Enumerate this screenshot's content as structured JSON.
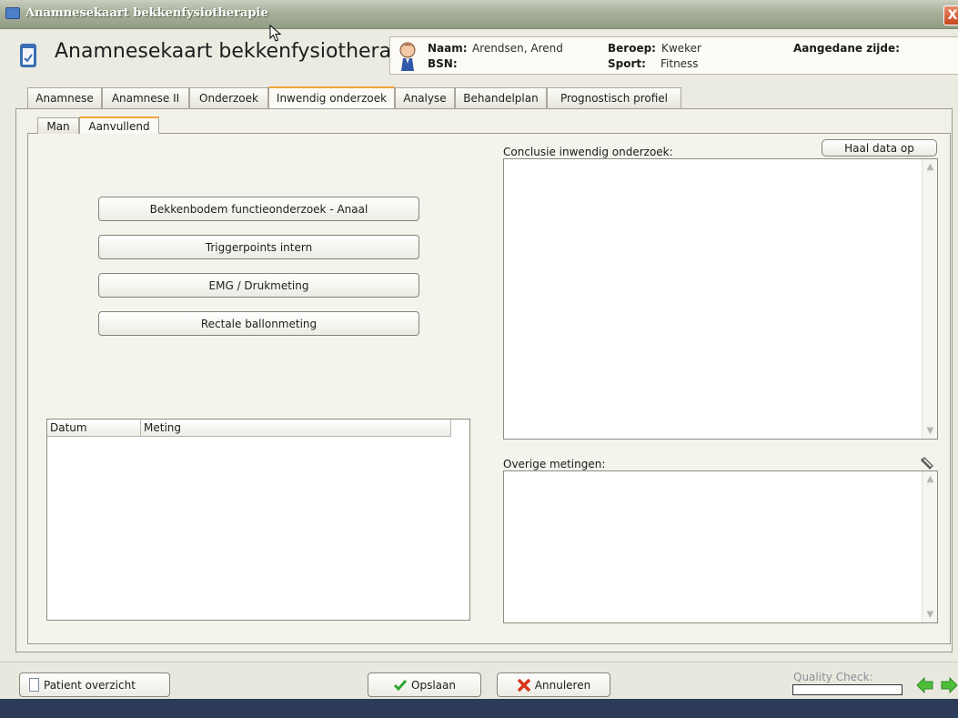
{
  "window": {
    "title": "Anamnesekaart bekkenfysiotherapie",
    "close_glyph": "X"
  },
  "header": {
    "app_title": "Anamnesekaart bekkenfysiotherapie",
    "patient": {
      "naam_label": "Naam:",
      "naam_value": "Arendsen, Arend",
      "bsn_label": "BSN:",
      "bsn_value": "",
      "beroep_label": "Beroep:",
      "beroep_value": "Kweker",
      "sport_label": "Sport:",
      "sport_value": "Fitness",
      "zijde_label": "Aangedane zijde:",
      "zijde_value": ""
    }
  },
  "tabs": [
    {
      "label": "Anamnese",
      "active": false
    },
    {
      "label": "Anamnese II",
      "active": false
    },
    {
      "label": "Onderzoek",
      "active": false
    },
    {
      "label": "Inwendig onderzoek",
      "active": true
    },
    {
      "label": "Analyse",
      "active": false
    },
    {
      "label": "Behandelplan",
      "active": false
    },
    {
      "label": "Prognostisch profiel",
      "active": false
    }
  ],
  "subtabs": [
    {
      "label": "Man",
      "active": false
    },
    {
      "label": "Aanvullend",
      "active": true
    }
  ],
  "actions": [
    "Bekkenbodem functieonderzoek - Anaal",
    "Triggerpoints intern",
    "EMG / Drukmeting",
    "Rectale ballonmeting"
  ],
  "grid": {
    "columns": [
      "Datum",
      "Meting"
    ],
    "rows": []
  },
  "conclusie": {
    "label": "Conclusie inwendig onderzoek:",
    "value": "",
    "fetch_button": "Haal data op"
  },
  "overige": {
    "label": "Overige metingen:",
    "value": ""
  },
  "footer": {
    "patient_button": "Patient overzicht",
    "save_button": "Opslaan",
    "cancel_button": "Annuleren",
    "quality_label": "Quality Check:",
    "quality_progress": 0
  },
  "colors": {
    "accent_tab": "#f0a43a",
    "save_check": "#2fa52f",
    "cancel_x": "#d8361e",
    "nav_arrow": "#4fbf3a"
  }
}
